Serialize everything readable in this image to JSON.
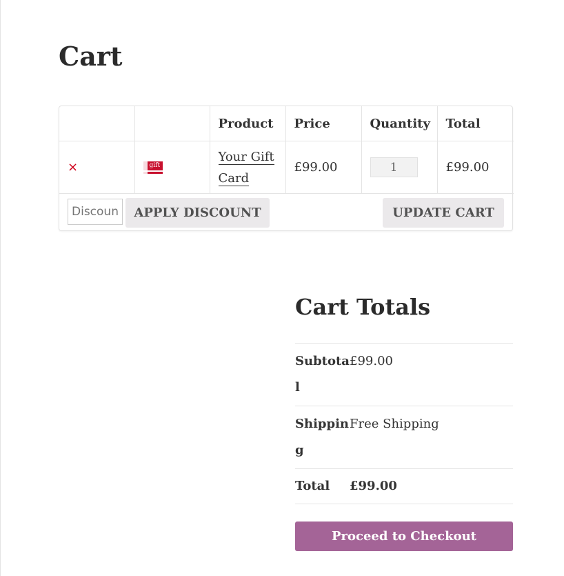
{
  "page": {
    "title": "Cart"
  },
  "cart_table": {
    "headers": [
      "",
      "",
      "Product",
      "Price",
      "Quantity",
      "Total"
    ],
    "items": [
      {
        "remove_symbol": "×",
        "thumbnail_text": "gift",
        "product_name": "Your Gift Card",
        "price": "£99.00",
        "quantity": "1",
        "total": "£99.00"
      }
    ]
  },
  "actions": {
    "coupon_placeholder": "Discount code",
    "apply_label": "APPLY DISCOUNT",
    "update_label": "UPDATE CART"
  },
  "totals": {
    "heading": "Cart Totals",
    "rows": [
      {
        "label": "Subtotal",
        "value": "£99.00"
      },
      {
        "label": "Shipping",
        "value": "Free Shipping"
      },
      {
        "label": "Total",
        "value": "£99.00"
      }
    ],
    "checkout_label": "Proceed to Checkout"
  },
  "colors": {
    "accent": "#a46497",
    "remove": "#d0021b",
    "button_grey": "#ebe9eb"
  }
}
